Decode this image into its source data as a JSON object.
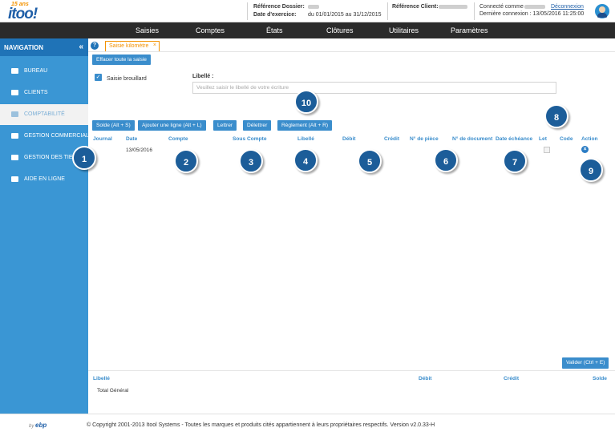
{
  "header": {
    "logo_badge": "15 ans",
    "logo_text": "itoo!",
    "ref_dossier_label": "Référence Dossier:",
    "exercice_label": "Date d'exercice:",
    "exercice_value": "du 01/01/2015 au 31/12/2015",
    "ref_client_label": "Référence Client:",
    "connected_label": "Connecté comme",
    "logout_link": "Déconnexion",
    "last_login": "Dernière connexion : 13/05/2016 11:25:00"
  },
  "topmenu": {
    "items": [
      "Saisies",
      "Comptes",
      "États",
      "Clôtures",
      "Utilitaires",
      "Paramètres"
    ]
  },
  "sidebar": {
    "title": "NAVIGATION",
    "collapse": "«",
    "items": [
      {
        "label": "BUREAU",
        "icon": "chart-icon"
      },
      {
        "label": "CLIENTS",
        "icon": "car-icon"
      },
      {
        "label": "COMPTABILITÉ",
        "icon": "calculator-icon"
      },
      {
        "label": "GESTION COMMERCIALE",
        "icon": "card-icon"
      },
      {
        "label": "GESTION DES TIERS",
        "icon": "users-icon"
      },
      {
        "label": "AIDE EN LIGNE",
        "icon": "book-icon"
      }
    ]
  },
  "tab": {
    "help": "?",
    "label": "Saisie kilomètre",
    "close": "×"
  },
  "form": {
    "clear_button": "Effacer toute la saisie",
    "draft_checkbox_label": "Saisie brouillard",
    "libelle_label": "Libellé :",
    "libelle_placeholder": "Veuillez saisir le libellé de votre écriture"
  },
  "toolbar": {
    "buttons": [
      "Solde (Alt + S)",
      "Ajouter une ligne (Alt + L)",
      "Lettrer",
      "Délettrer",
      "Règlement (Alt + R)"
    ]
  },
  "table": {
    "headers": [
      "Journal",
      "Date",
      "Compte",
      "Sous Compte",
      "Libellé",
      "Débit",
      "Crédit",
      "N° de pièce",
      "N° de document",
      "Date échéance",
      "Let",
      "Code",
      "Action"
    ],
    "row": {
      "date": "13/05/2016"
    }
  },
  "callouts": [
    "1",
    "2",
    "3",
    "4",
    "5",
    "6",
    "7",
    "8",
    "9",
    "10"
  ],
  "validate_button": "Valider (Ctrl + E)",
  "totals": {
    "headers": [
      "Libellé",
      "Débit",
      "Crédit",
      "Solde"
    ],
    "total_label": "Total Général"
  },
  "footer": {
    "by": "by",
    "brand": "ebp",
    "copyright": "© Copyright 2001-2013 Itool Systems - Toutes les marques et produits cités appartiennent à leurs propriétaires respectifs. Version v2.0.33-H"
  }
}
